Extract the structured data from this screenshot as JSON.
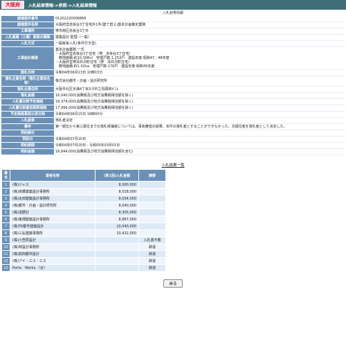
{
  "header": {
    "brand": "大阪府",
    "breadcrumb": "入札結果情報->参照->入札結果情報"
  },
  "detail": {
    "title": "入札結果情報",
    "rows": [
      {
        "label": "調達案件番号",
        "value": "01202220006866"
      },
      {
        "label": "調達案件名称",
        "value": "大阪府営赤坂台3丁住宅外1件(建て替え)基本計画策定業務"
      },
      {
        "label": "工事場所",
        "value": "堺市南区赤坂台3丁外"
      },
      {
        "label": "入札業種（工種）業務の種類",
        "value": "建築設計-監理（一般）"
      },
      {
        "label": "入札方式",
        "value": "一般競争入札(条件付き型)"
      },
      {
        "label": "工事設計概要",
        "value": "基本計画業務 一式\n・大阪府営赤坂台3丁住宅（堺　赤坂台3丁住宅）\n　敷地面積:約10,308㎡　管理戸数:1,253戸　建設年度:昭和47、48年度\n・大阪府営堺深井沢町住宅（堺　深井沢町住宅）\n　敷地面積:約1.02ha　管理戸数:176戸　建設年度:昭和45年度"
      },
      {
        "label": "開札日時",
        "value": "令和04年06月13日 10時15分"
      },
      {
        "label": "落札企業名称（落札企業体名称）",
        "value": "株式会社都市・計画・設計研究所"
      },
      {
        "label": "落札企業住所",
        "value": "大阪市北区天満4丁目3-5中之島岡田ビル"
      },
      {
        "label": "落札金額",
        "value": "16,040,000(消費税及び地方消費税相当額を除く)"
      },
      {
        "label": "入札書比較予定価格",
        "value": "18,374,000(消費税及び地方消費税相当額を除く)"
      },
      {
        "label": "入札書比較最低制限価格",
        "value": "17,996,000(消費税及び地方消費税相当額を除く)"
      },
      {
        "label": "予定価格事前公表日時",
        "value": "令和04年06月15日 16時00分"
      },
      {
        "label": "入札結果",
        "value": "落札者決定"
      },
      {
        "label": "備考",
        "value": "第一順位から第三順位までの落札候補者については、事後審査の結果、本件の落札者とすることができなかった。次順位者を落札者として決定した。"
      },
      {
        "label": "契約締日",
        "value": ""
      },
      {
        "label": "契約日",
        "value": "令和04年07月20日"
      },
      {
        "label": "契約期間",
        "value": "令和04年07月20日 - 令和05年03月01日"
      },
      {
        "label": "契約金額",
        "value": "16,844,000(消費税及び地方消費税相当額を含む)"
      }
    ]
  },
  "bid_list": {
    "title": "入札結果一覧",
    "headers": [
      "番号",
      "業者名称",
      "(第1回)入札金額",
      "摘要"
    ],
    "rows": [
      {
        "no": "1",
        "name": "(株)ジャス",
        "amount": "8,000,000",
        "remark": ""
      },
      {
        "no": "2",
        "name": "(株)高橋建築設計事務所",
        "amount": "8,018,000",
        "remark": ""
      },
      {
        "no": "3",
        "name": "(株)太田建築設計事務所",
        "amount": "8,034,000",
        "remark": ""
      },
      {
        "no": "4",
        "name": "(株)都市・計画・設計研究所",
        "amount": "8,040,000",
        "remark": ""
      },
      {
        "no": "5",
        "name": "(株)浅野計",
        "amount": "8,305,000",
        "remark": ""
      },
      {
        "no": "6",
        "name": "(株)東畑建築設計事務所",
        "amount": "8,867,000",
        "remark": ""
      },
      {
        "no": "7",
        "name": "(株)TK都市建築設計",
        "amount": "10,040,000",
        "remark": ""
      },
      {
        "no": "8",
        "name": "(株)三弘建築事務所",
        "amount": "10,432,000",
        "remark": ""
      },
      {
        "no": "9",
        "name": "(株)小笠原設計",
        "amount": "",
        "remark": "入札書不着"
      },
      {
        "no": "10",
        "name": "(株)林設計事務所",
        "amount": "",
        "remark": "辞退"
      },
      {
        "no": "11",
        "name": "(株)前田都市設計",
        "amount": "",
        "remark": "辞退"
      },
      {
        "no": "12",
        "name": "(株)アイ・エス・エス",
        "amount": "",
        "remark": "辞退"
      },
      {
        "no": "13",
        "name": "Porta　Works.（合）",
        "amount": "",
        "remark": "辞退"
      }
    ]
  },
  "footer": {
    "back_label": "戻る"
  }
}
